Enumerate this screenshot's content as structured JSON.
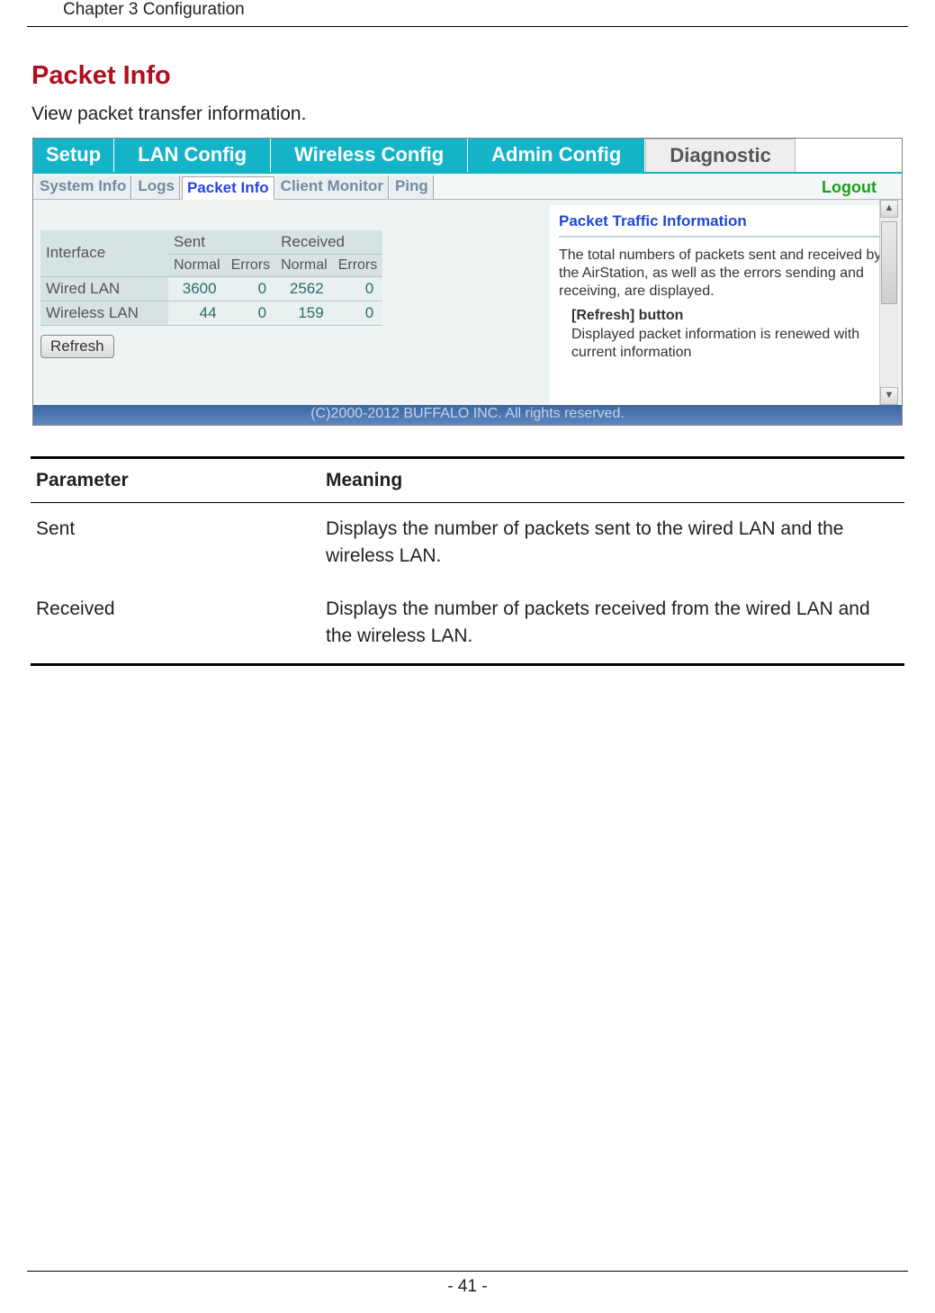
{
  "page": {
    "chapter": "Chapter 3  Configuration",
    "section_title": "Packet Info",
    "intro": "View packet transfer information.",
    "footer": "- 41 -"
  },
  "main_tabs": {
    "setup": "Setup",
    "lan": "LAN Config",
    "wireless": "Wireless Config",
    "admin": "Admin Config",
    "diag": "Diagnostic"
  },
  "sub_tabs": {
    "sysinfo": "System Info",
    "logs": "Logs",
    "packet": "Packet Info",
    "client": "Client Monitor",
    "ping": "Ping"
  },
  "logout": "Logout",
  "pkt_table": {
    "interface": "Interface",
    "sent": "Sent",
    "received": "Received",
    "normal": "Normal",
    "errors": "Errors",
    "rows": [
      {
        "label": "Wired LAN",
        "sent_n": "3600",
        "sent_e": "0",
        "recv_n": "2562",
        "recv_e": "0"
      },
      {
        "label": "Wireless LAN",
        "sent_n": "44",
        "sent_e": "0",
        "recv_n": "159",
        "recv_e": "0"
      }
    ],
    "refresh": "Refresh"
  },
  "info": {
    "title": "Packet Traffic Information",
    "p1": "The total numbers of packets sent and received by the AirStation, as well as the errors sending and receiving, are displayed.",
    "sub": "[Refresh] button",
    "p2": "Displayed packet information is renewed with current information"
  },
  "copyright": "(C)2000-2012 BUFFALO INC. All rights reserved.",
  "param_table": {
    "h1": "Parameter",
    "h2": "Meaning",
    "rows": [
      {
        "p": "Sent",
        "m": "Displays the number of packets sent to the wired LAN and the wireless LAN."
      },
      {
        "p": "Received",
        "m": "Displays the number of packets received from the wired LAN and the wireless LAN."
      }
    ]
  }
}
